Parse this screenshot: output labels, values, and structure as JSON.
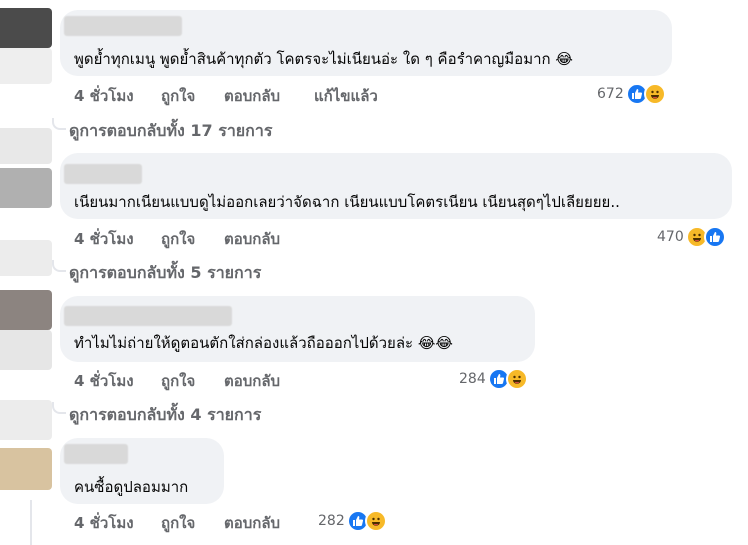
{
  "comments": [
    {
      "text": "พูดย้ำทุกเมนู พูดย้ำสินค้าทุกตัว โคตรจะไม่เนียนอ่ะ ใด ๆ คือรำคาญมือมาก 😂",
      "time": "4 ชั่วโมง",
      "like": "ถูกใจ",
      "reply": "ตอบกลับ",
      "edited": "แก้ไขแล้ว",
      "reaction_count": "672",
      "replies_link": "ดูการตอบกลับทั้ง 17 รายการ",
      "reaction_icons": [
        "like-icon",
        "haha-icon"
      ]
    },
    {
      "text": "เนียนมากเนียนแบบดูไม่ออกเลยว่าจัดฉาก เนียนแบบโคตรเนียน เนียนสุดๆไปเลียยยย..",
      "time": "4 ชั่วโมง",
      "like": "ถูกใจ",
      "reply": "ตอบกลับ",
      "reaction_count": "470",
      "replies_link": "ดูการตอบกลับทั้ง 5 รายการ",
      "reaction_icons": [
        "haha-icon",
        "like-icon"
      ]
    },
    {
      "text": "ทำไมไม่ถ่ายให้ดูตอนตักใส่กล่องแล้วถือออกไปด้วยล่ะ 😂😂",
      "time": "4 ชั่วโมง",
      "like": "ถูกใจ",
      "reply": "ตอบกลับ",
      "reaction_count": "284",
      "replies_link": "ดูการตอบกลับทั้ง 4 รายการ",
      "reaction_icons": [
        "like-icon",
        "haha-icon"
      ]
    },
    {
      "text": "คนซื้อดูปลอมมาก",
      "time": "4 ชั่วโมง",
      "like": "ถูกใจ",
      "reply": "ตอบกลับ",
      "reaction_count": "282",
      "reaction_icons": [
        "like-icon",
        "haha-icon"
      ]
    }
  ],
  "colors": {
    "bubble": "#f0f2f5",
    "meta_text": "#65676b",
    "like_blue": "#1877f2",
    "haha_yellow": "#f7b928"
  }
}
